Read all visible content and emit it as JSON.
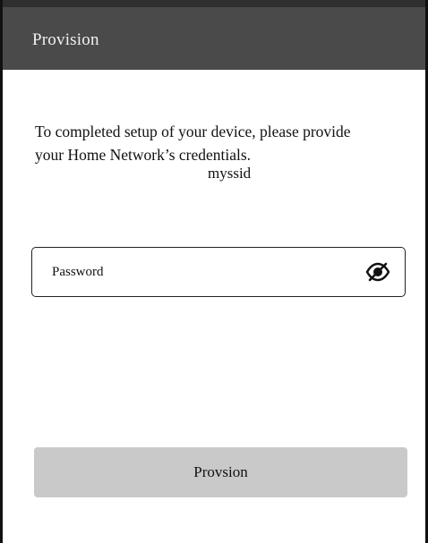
{
  "app_bar": {
    "title": "Provision"
  },
  "content": {
    "instructions": "To completed setup of your device, please provide your Home Network’s credentials.",
    "ssid": "myssid"
  },
  "password_field": {
    "placeholder": "Password",
    "value": "",
    "toggle_icon": "eye-off-icon"
  },
  "provision_button": {
    "label": "Provsion"
  },
  "colors": {
    "app_bar_background": "#4a4a4a",
    "app_bar_top_edge": "#2f2f2f",
    "app_bar_text": "#f2f2f2",
    "button_background": "#c9c9c9",
    "text": "#111111",
    "page_background": "#ffffff"
  }
}
